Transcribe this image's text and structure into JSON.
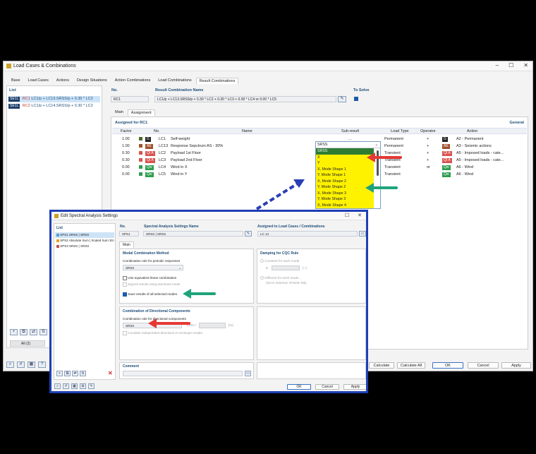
{
  "main_window": {
    "title": "Load Cases & Combinations",
    "controls": [
      "–",
      "☐",
      "✕"
    ],
    "tabs": [
      "Base",
      "Load Cases",
      "Actions",
      "Design Situations",
      "Action Combinations",
      "Load Combinations",
      "Result Combinations"
    ],
    "active_tab": "Result Combinations",
    "list_header": "List",
    "list_items": [
      {
        "tag": "SE1L",
        "id": "RC1",
        "text": "LC1/p + LC13.SRSS/p + 0.30 * LC2"
      },
      {
        "tag": "SE1L",
        "id": "RC2",
        "text": "LC1/p + LC14.SRSS/p + 0.30 * LC2"
      }
    ],
    "no_label": "No.",
    "no_value": "RC1",
    "name_label": "Result Combination Name",
    "name_value": "LC1/p + LC13.SRSS/p + 0.30 * LC2 + 0.30 * LC3 + 0.00 * LC4 or 0.00 * LC5",
    "to_solve_label": "To Solve",
    "subtabs": [
      "Main",
      "Assignment"
    ],
    "active_subtab": "Assignment",
    "assigned_label": "Assigned for RC1",
    "general_link": "General",
    "columns": [
      "Factor",
      "No.",
      "Name",
      "Sub-result",
      "Load Type",
      "Operator",
      "Action"
    ],
    "rows": [
      {
        "factor": "1.00",
        "tag": "G",
        "tag_color": "#222222",
        "swatch": "#4a6b2a",
        "lc": "LC1",
        "name": "Self-weight",
        "sub": "...",
        "load_type": "Permanent",
        "operator": "+",
        "action_tag": "G",
        "action_tag_color": "#222222",
        "action": "A2 - Permanent"
      },
      {
        "factor": "1.00",
        "tag": "AE",
        "tag_color": "#a0522d",
        "swatch": "#a0522d",
        "lc": "LC13",
        "name": "Response Sepctrum AS - 30%",
        "sub": "SRSS",
        "load_type": "Permanent",
        "operator": "+",
        "action_tag": "AE",
        "action_tag_color": "#a0522d",
        "action": "A3 - Seismic actions"
      },
      {
        "factor": "0.30",
        "tag": "QI A",
        "tag_color": "#d9534f",
        "swatch": "#d9534f",
        "lc": "LC2",
        "name": "Payload 1st Floor",
        "sub": "",
        "load_type": "Transient",
        "operator": "+",
        "action_tag": "QI A",
        "action_tag_color": "#d9534f",
        "action": "A5 - Imposed loads - cate..."
      },
      {
        "factor": "0.30",
        "tag": "QI A",
        "tag_color": "#d9534f",
        "swatch": "#d9534f",
        "lc": "LC3",
        "name": "Payload 2nd Floor",
        "sub": "",
        "load_type": "Transient",
        "operator": "+",
        "action_tag": "QI A",
        "action_tag_color": "#d9534f",
        "action": "A5 - Imposed loads - cate..."
      },
      {
        "factor": "0.00",
        "tag": "Qw",
        "tag_color": "#2e9e4f",
        "swatch": "#2e9e4f",
        "lc": "LC4",
        "name": "Wind in X",
        "sub": "",
        "load_type": "Transient",
        "operator": "or",
        "action_tag": "Qw",
        "action_tag_color": "#2e9e4f",
        "action": "A6 - Wind"
      },
      {
        "factor": "0.00",
        "tag": "Qw",
        "tag_color": "#2e9e4f",
        "swatch": "#2e9e4f",
        "lc": "LC5",
        "name": "Wind in Y",
        "sub": "",
        "load_type": "Transient",
        "operator": "",
        "action_tag": "Qw",
        "action_tag_color": "#2e9e4f",
        "action": "A6 - Wind"
      }
    ],
    "dropdown_items": [
      "SRSS",
      "X",
      "Y",
      "X, Mode Shape 1",
      "Y, Mode Shape 1",
      "X, Mode Shape 2",
      "Y, Mode Shape 2",
      "X, Mode Shape 3",
      "Y, Mode Shape 3",
      "X, Mode Shape 4"
    ],
    "dropdown_selected": "SRSS",
    "all_count": "All (2)",
    "buttons": {
      "calculate": "Calculate",
      "calculate_all": "Calculate All",
      "ok": "OK",
      "cancel": "Cancel",
      "apply": "Apply"
    }
  },
  "dialog": {
    "title": "Edit Spectral Analysis Settings",
    "list_header": "List",
    "list_items": [
      {
        "id": "SPS1",
        "text": "SRSS | SRSS",
        "color": "#5b9bd5"
      },
      {
        "id": "SPS2",
        "text": "Absolute Sum | Scaled Sum 30.0",
        "color": "#e6a117"
      },
      {
        "id": "SPS3",
        "text": "SRSS | SRSS",
        "color": "#c0504d"
      }
    ],
    "no_label": "No.",
    "no_value": "SPS1",
    "name_label": "Spectral Analysis Settings Name",
    "name_value": "SRSS | SRSS",
    "assigned_label": "Assigned to Load Cases / Combinations",
    "assigned_value": "LC 14",
    "tab": "Main",
    "modal_title": "Modal Combination Method",
    "periodic_label": "Combination rule for periodic responses",
    "periodic_value": "SRSS",
    "equiv_linear": "Use equivalent linear combination",
    "signed_results": "Signed results using dominant mode",
    "save_results": "Save results of all selected modes",
    "damping_title": "Damping for CQC Rule",
    "constant_each": "Constant for each mode",
    "d_label": "D",
    "d_unit": "[--]",
    "different_each": "Different for each mode...",
    "different_note": "(Set in Selection of Mode Tab)",
    "directional_title": "Combination of Directional Components",
    "directional_label": "Combination rule for directional components",
    "directional_value": "SRSS",
    "percent": "100% /",
    "percent_unit": "[%]",
    "consider_independent": "Consider independent directions in envelope results",
    "comment_label": "Comment",
    "buttons": {
      "ok": "OK",
      "cancel": "Cancel",
      "apply": "Apply"
    }
  },
  "colors": {
    "accent_blue": "#1f4e79",
    "dialog_border": "#1f3fb5",
    "arrow_red": "#e53935",
    "arrow_green": "#1fa37a",
    "arrow_blue": "#2a3fb5",
    "dropdown_yellow": "#fff200"
  }
}
